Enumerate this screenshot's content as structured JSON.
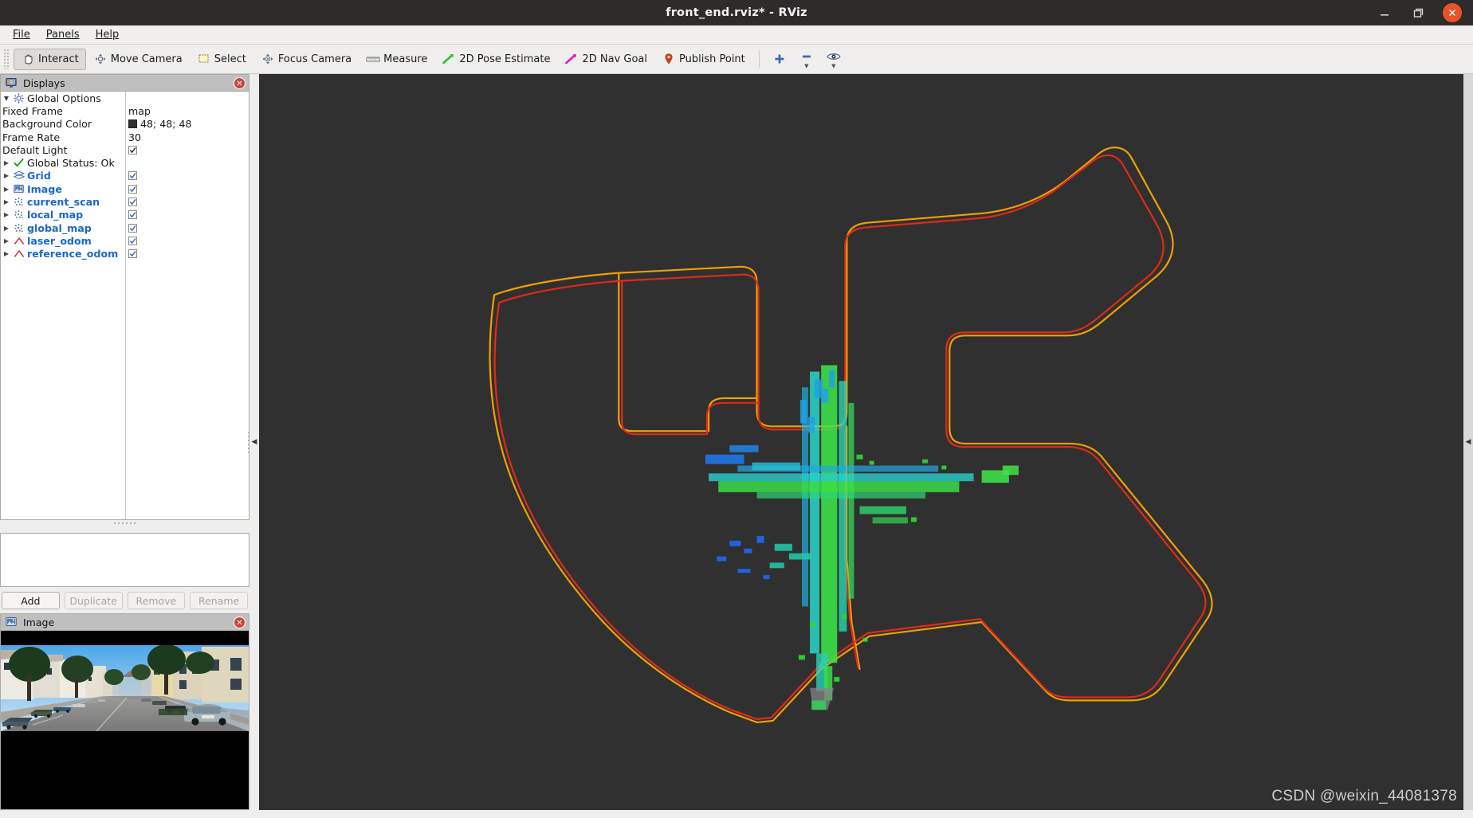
{
  "window": {
    "title": "front_end.rviz* - RViz",
    "minimize_label": "Minimize",
    "maximize_label": "Restore",
    "close_label": "Close"
  },
  "menubar": {
    "items": [
      {
        "label": "File"
      },
      {
        "label": "Panels"
      },
      {
        "label": "Help"
      }
    ]
  },
  "toolbar": {
    "tools": [
      {
        "label": "Interact",
        "icon": "hand-cursor-icon",
        "active": true
      },
      {
        "label": "Move Camera",
        "icon": "move-camera-icon",
        "active": false
      },
      {
        "label": "Select",
        "icon": "select-rect-icon",
        "active": false
      },
      {
        "label": "Focus Camera",
        "icon": "focus-camera-icon",
        "active": false
      },
      {
        "label": "Measure",
        "icon": "ruler-icon",
        "active": false
      },
      {
        "label": "2D Pose Estimate",
        "icon": "green-arrow-icon",
        "active": false
      },
      {
        "label": "2D Nav Goal",
        "icon": "magenta-arrow-icon",
        "active": false
      },
      {
        "label": "Publish Point",
        "icon": "map-pin-icon",
        "active": false
      }
    ],
    "extras": [
      {
        "icon": "plus-icon",
        "label": "Add tool"
      },
      {
        "icon": "minus-icon",
        "label": "Remove tool"
      },
      {
        "icon": "eye-icon",
        "label": "Tool visibility"
      }
    ]
  },
  "displays_panel": {
    "title": "Displays",
    "close_label": "Close Displays panel",
    "tree": [
      {
        "label": "Global Options",
        "icon": "gear-icon",
        "arrow": "open",
        "kind": "group",
        "children": [
          {
            "label": "Fixed Frame",
            "value": "map",
            "kind": "text"
          },
          {
            "label": "Background Color",
            "value": "48; 48; 48",
            "kind": "color",
            "color": "#303030"
          },
          {
            "label": "Frame Rate",
            "value": "30",
            "kind": "text"
          },
          {
            "label": "Default Light",
            "value": "",
            "kind": "checkbox",
            "checked": true
          }
        ]
      },
      {
        "label": "Global Status: Ok",
        "icon": "check-icon",
        "arrow": "closed",
        "kind": "status"
      },
      {
        "label": "Grid",
        "icon": "grid-icon",
        "arrow": "closed",
        "kind": "display",
        "checked": true
      },
      {
        "label": "Image",
        "icon": "image-icon",
        "arrow": "closed",
        "kind": "display",
        "checked": true
      },
      {
        "label": "current_scan",
        "icon": "pointcloud-icon",
        "arrow": "closed",
        "kind": "display",
        "checked": true
      },
      {
        "label": "local_map",
        "icon": "pointcloud-icon",
        "arrow": "closed",
        "kind": "display",
        "checked": true
      },
      {
        "label": "global_map",
        "icon": "pointcloud-icon",
        "arrow": "closed",
        "kind": "display",
        "checked": true
      },
      {
        "label": "laser_odom",
        "icon": "odometry-icon",
        "arrow": "closed",
        "kind": "display",
        "checked": true
      },
      {
        "label": "reference_odom",
        "icon": "odometry-icon",
        "arrow": "closed",
        "kind": "display",
        "checked": true
      }
    ],
    "buttons": [
      {
        "label": "Add",
        "enabled": true
      },
      {
        "label": "Duplicate",
        "enabled": false
      },
      {
        "label": "Remove",
        "enabled": false
      },
      {
        "label": "Rename",
        "enabled": false
      }
    ]
  },
  "image_panel": {
    "title": "Image",
    "close_label": "Close Image panel"
  },
  "view3d": {
    "background_color": "#303030",
    "watermark": "CSDN @weixin_44081378",
    "colors": {
      "laser_odom_path": "#e02b16",
      "reference_odom_path": "#f0a000",
      "cloud_low": "#2a6cff",
      "cloud_mid": "#18e0c8",
      "cloud_high": "#2fdb2f"
    }
  },
  "splitters": {
    "left_collapse_label": "Collapse left dock",
    "right_collapse_label": "Collapse right dock"
  }
}
